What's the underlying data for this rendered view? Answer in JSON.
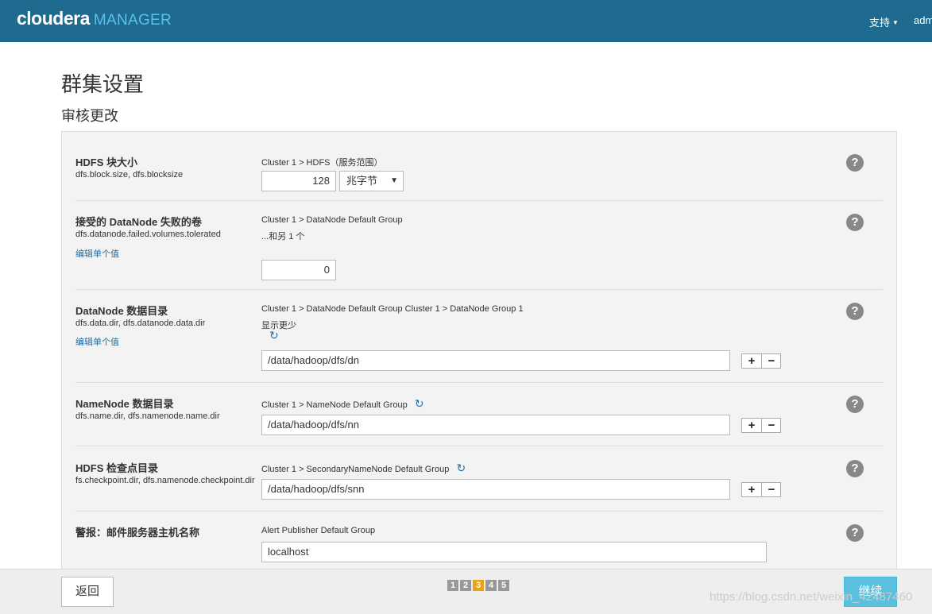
{
  "header": {
    "brand": "cloudera",
    "product": "MANAGER",
    "support": "支持",
    "user": "adm"
  },
  "page": {
    "title": "群集设置",
    "subtitle": "审核更改"
  },
  "settings": [
    {
      "name": "HDFS 块大小",
      "keys": "dfs.block.size, dfs.blocksize",
      "scope": "Cluster 1 > HDFS（服务范围）",
      "value": "128",
      "unit": "兆字节"
    },
    {
      "name": "接受的 DataNode 失败的卷",
      "keys": "dfs.datanode.failed.volumes.tolerated",
      "edit": "编辑单个值",
      "scope": "Cluster 1 > DataNode Default Group",
      "extra": "...和另 1 个",
      "value": "0"
    },
    {
      "name": "DataNode 数据目录",
      "keys": "dfs.data.dir, dfs.datanode.data.dir",
      "edit": "编辑单个值",
      "scope": "Cluster 1 > DataNode Default Group Cluster 1 > DataNode Group 1",
      "extra": "显示更少",
      "value": "/data/hadoop/dfs/dn"
    },
    {
      "name": "NameNode 数据目录",
      "keys": "dfs.name.dir, dfs.namenode.name.dir",
      "scope": "Cluster 1 > NameNode Default Group",
      "value": "/data/hadoop/dfs/nn"
    },
    {
      "name": "HDFS 检查点目录",
      "keys": "fs.checkpoint.dir, dfs.namenode.checkpoint.dir",
      "scope": "Cluster 1 > SecondaryNameNode Default Group",
      "value": "/data/hadoop/dfs/snn"
    },
    {
      "name": "警报：邮件服务器主机名称",
      "scope": "Alert Publisher Default Group",
      "value": "localhost"
    }
  ],
  "icons": {
    "help": "?",
    "refresh": "↻",
    "plus": "+",
    "minus": "−"
  },
  "footer": {
    "back": "返回",
    "steps": [
      "1",
      "2",
      "3",
      "4",
      "5"
    ],
    "current_step": 3,
    "continue": "继续",
    "watermark": "https://blog.csdn.net/weixin_42487460"
  },
  "colors": {
    "header_bg": "#1f6b8f",
    "brand_accent": "#5bc0ea",
    "link": "#1e6fa8",
    "active_step": "#e8a317",
    "continue_bg": "#5bc0de"
  }
}
